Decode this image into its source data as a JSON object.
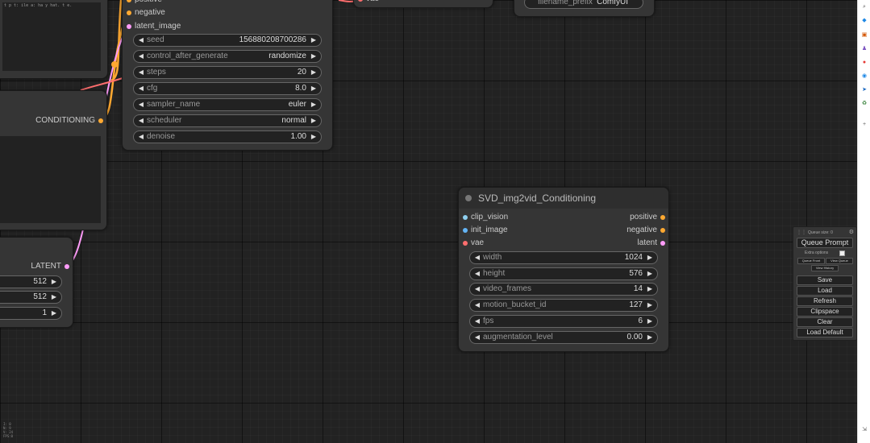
{
  "colors": {
    "clip_vision": "#8fd0f0",
    "image": "#64b5f6",
    "vae": "#ff6e6e",
    "conditioning": "#ffa931",
    "latent": "#ff9cf9"
  },
  "top_left_node": {
    "note_text": "t  p t: ile  a: ha y  hat. t  e."
  },
  "conditioning_node": {
    "output": "CONDITIONING"
  },
  "latent_node": {
    "output": "LATENT",
    "widgets": [
      {
        "value": "512"
      },
      {
        "value": "512"
      },
      {
        "value": "1"
      }
    ]
  },
  "ksampler": {
    "inputs": [
      "positive",
      "negative",
      "latent_image"
    ],
    "widgets": [
      {
        "label": "seed",
        "value": "156880208700286"
      },
      {
        "label": "control_after_generate",
        "value": "randomize"
      },
      {
        "label": "steps",
        "value": "20"
      },
      {
        "label": "cfg",
        "value": "8.0"
      },
      {
        "label": "sampler_name",
        "value": "euler"
      },
      {
        "label": "scheduler",
        "value": "normal"
      },
      {
        "label": "denoise",
        "value": "1.00"
      }
    ]
  },
  "vae_decode_stub": {
    "input": "vae"
  },
  "save_node": {
    "widget_label": "filename_prefix",
    "widget_value": "ComfyUI"
  },
  "svd_node": {
    "title": "SVD_img2vid_Conditioning",
    "inputs": [
      "clip_vision",
      "init_image",
      "vae"
    ],
    "outputs": [
      "positive",
      "negative",
      "latent"
    ],
    "widgets": [
      {
        "label": "width",
        "value": "1024"
      },
      {
        "label": "height",
        "value": "576"
      },
      {
        "label": "video_frames",
        "value": "14"
      },
      {
        "label": "motion_bucket_id",
        "value": "127"
      },
      {
        "label": "fps",
        "value": "6"
      },
      {
        "label": "augmentation_level",
        "value": "0.00"
      }
    ]
  },
  "queue_menu": {
    "title": "Queue size: 0",
    "queue_prompt": "Queue Prompt",
    "extra_options": "Extra options",
    "queue_front": "Queue Front",
    "view_queue": "View Queue",
    "view_history": "View History",
    "buttons": [
      "Save",
      "Load",
      "Refresh",
      "Clipspace",
      "Clear",
      "Load Default"
    ]
  },
  "stats": [
    "I: 0",
    "N: 9",
    "V: 24",
    "FPS:0"
  ]
}
